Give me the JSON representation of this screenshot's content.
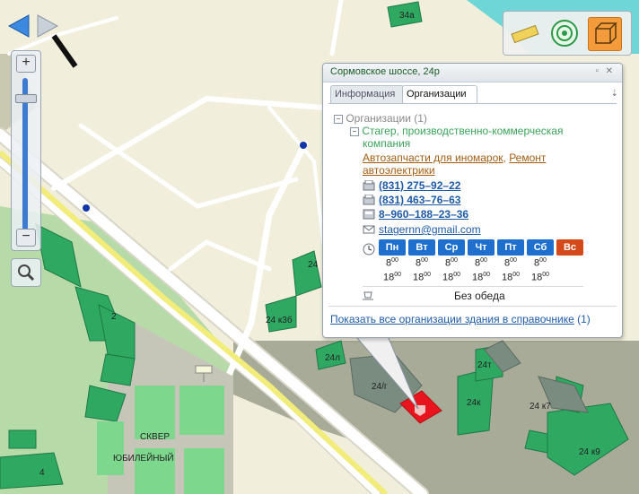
{
  "map": {
    "labels": {
      "b34a": "34а",
      "b24": "24",
      "b24k3b": "24 к3б",
      "b24l": "24л",
      "b24g": "24/г",
      "b24t": "24т",
      "b24k": "24к",
      "b24k7": "24 к7",
      "b24k9": "24 к9",
      "b2": "2",
      "b4": "4",
      "park1": "СКВЕР",
      "park2": "ЮБИЛЕЙНЫЙ"
    }
  },
  "popup": {
    "title": "Сормовское шоссе, 24р",
    "tabs": {
      "info": "Информация",
      "orgs": "Организации"
    },
    "tree_root": "Организации (1)",
    "org_name_1": "Стагер, производственно-коммерческая",
    "org_name_2": "компания",
    "category_1": "Автозапчасти для иномарок",
    "category_sep": ",",
    "category_2": "Ремонт",
    "category_2b": "автоэлектрики",
    "phone_1": "(831) 275–92–22",
    "phone_2": "(831) 463–76–63",
    "phone_3": "8–960–188–23–36",
    "email": "stagernn@gmail.com",
    "days": [
      "Пн",
      "Вт",
      "Ср",
      "Чт",
      "Пт",
      "Сб",
      "Вс"
    ],
    "open": [
      "8",
      "8",
      "8",
      "8",
      "8",
      "8"
    ],
    "close": [
      "18",
      "18",
      "18",
      "18",
      "18",
      "18"
    ],
    "minutes": "00",
    "lunch": "Без обеда",
    "footer_link": "Показать все организации здания в справочнике",
    "footer_count": "(1)"
  },
  "colors": {
    "workday": "#1f6fcf",
    "sunday": "#d44a1a",
    "selected_building": "#e8141e",
    "building": "#2fa862",
    "water": "#6fd6d8"
  },
  "icons": {
    "nav": [
      "arrow-left-icon",
      "arrow-right-icon"
    ],
    "zoom": [
      "zoom-in-icon",
      "zoom-out-icon"
    ],
    "tools": [
      "ruler-icon",
      "radar-icon",
      "3d-box-icon"
    ]
  }
}
